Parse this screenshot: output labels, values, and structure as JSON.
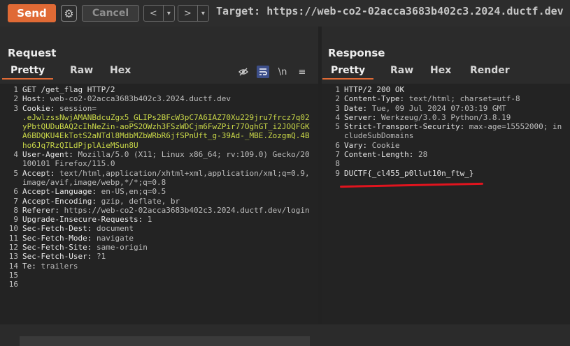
{
  "toolbar": {
    "send_label": "Send",
    "cancel_label": "Cancel",
    "back_label": "<",
    "forward_label": ">",
    "dropdown_glyph": "▾",
    "target_text": "Target: https://web-co2-02acca3683b402c3.2024.ductf.dev"
  },
  "request": {
    "title": "Request",
    "tabs": [
      "Pretty",
      "Raw",
      "Hex"
    ],
    "active_tab": "Pretty",
    "icons": [
      "eye-off-icon",
      "wrap-icon",
      "newline-icon",
      "menu-icon"
    ],
    "newline_label": "\\n",
    "lines": [
      {
        "num": "1",
        "header": "GET /get_flag HTTP/2",
        "value": ""
      },
      {
        "num": "2",
        "header": "Host:",
        "value": " web-co2-02acca3683b402c3.2024.ductf.dev"
      },
      {
        "num": "3",
        "header": "Cookie:",
        "value": " session="
      },
      {
        "num": "",
        "header": "",
        "cookie": ".eJwlzssNwjAMANBdcuZgx5_GLIPs2BFcW3pC7A6IAZ70Xu229jru7frcz7q02yPbtQUDuBAQ2cIhNeZin-aoPS2OWzh3FSzWDCjm6FwZPir77OghGT_i2JOQFGKA6BDQKU4EkTotS2aNTdl8MdbMZbWRbR6jfSPnUft_g-39Ad-_MBE.ZozgmQ.4Bho6Jq7RzQILdPjplAieMSun8U",
        "value": ""
      },
      {
        "num": "4",
        "header": "User-Agent:",
        "value": " Mozilla/5.0 (X11; Linux x86_64; rv:109.0) Gecko/20100101 Firefox/115.0"
      },
      {
        "num": "5",
        "header": "Accept:",
        "value": " text/html,application/xhtml+xml,application/xml;q=0.9,image/avif,image/webp,*/*;q=0.8"
      },
      {
        "num": "6",
        "header": "Accept-Language:",
        "value": " en-US,en;q=0.5"
      },
      {
        "num": "7",
        "header": "Accept-Encoding:",
        "value": " gzip, deflate, br"
      },
      {
        "num": "8",
        "header": "Referer:",
        "value": " https://web-co2-02acca3683b402c3.2024.ductf.dev/login"
      },
      {
        "num": "9",
        "header": "Upgrade-Insecure-Requests:",
        "value": " 1"
      },
      {
        "num": "10",
        "header": "Sec-Fetch-Dest:",
        "value": " document"
      },
      {
        "num": "11",
        "header": "Sec-Fetch-Mode:",
        "value": " navigate"
      },
      {
        "num": "12",
        "header": "Sec-Fetch-Site:",
        "value": " same-origin"
      },
      {
        "num": "13",
        "header": "Sec-Fetch-User:",
        "value": " ?1"
      },
      {
        "num": "14",
        "header": "Te:",
        "value": " trailers"
      },
      {
        "num": "15",
        "header": "",
        "value": ""
      },
      {
        "num": "16",
        "header": "",
        "value": ""
      }
    ]
  },
  "response": {
    "title": "Response",
    "tabs": [
      "Pretty",
      "Raw",
      "Hex",
      "Render"
    ],
    "active_tab": "Pretty",
    "lines": [
      {
        "num": "1",
        "header": "HTTP/2 200 OK",
        "value": ""
      },
      {
        "num": "2",
        "header": "Content-Type:",
        "value": " text/html; charset=utf-8"
      },
      {
        "num": "3",
        "header": "Date:",
        "value": " Tue, 09 Jul 2024 07:03:19 GMT"
      },
      {
        "num": "4",
        "header": "Server:",
        "value": " Werkzeug/3.0.3 Python/3.8.19"
      },
      {
        "num": "5",
        "header": "Strict-Transport-Security:",
        "value": " max-age=15552000; includeSubDomains"
      },
      {
        "num": "6",
        "header": "Vary:",
        "value": " Cookie"
      },
      {
        "num": "7",
        "header": "Content-Length:",
        "value": " 28"
      },
      {
        "num": "8",
        "header": "",
        "value": ""
      },
      {
        "num": "9",
        "header": "DUCTF{_cl455_p0llut10n_ftw_}",
        "value": ""
      }
    ]
  },
  "colors": {
    "accent": "#e06a35",
    "cookie": "#c8d648",
    "highlight_underline": "#e0141e"
  }
}
